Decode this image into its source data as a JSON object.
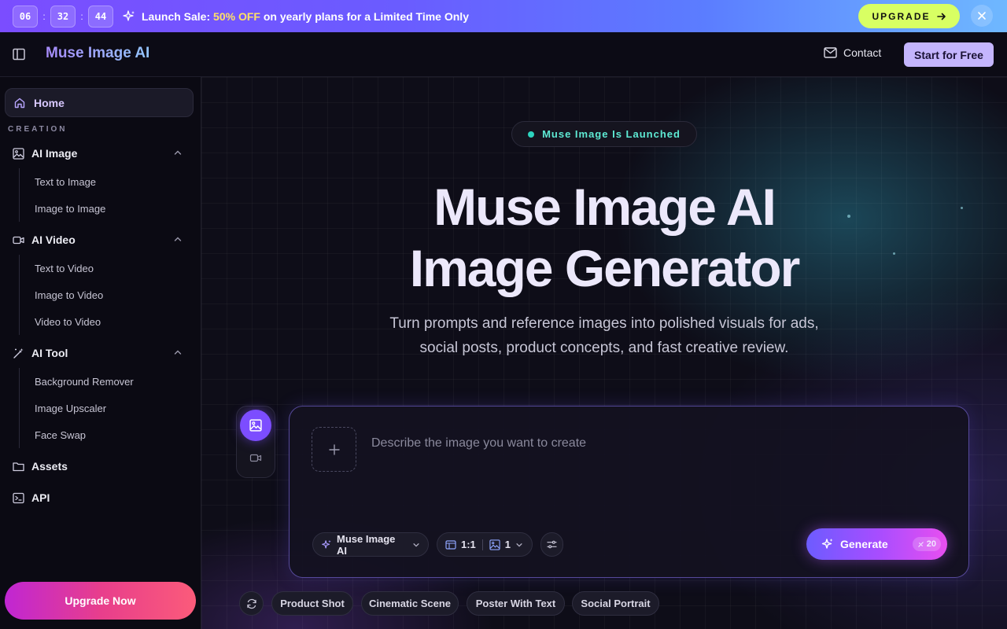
{
  "promo": {
    "hours": "06",
    "minutes": "32",
    "seconds": "44",
    "separator": ":",
    "text_prefix": "Launch Sale: ",
    "text_highlight": "50% OFF",
    "text_suffix": " on yearly plans for a Limited Time Only",
    "upgrade_label": "UPGRADE",
    "highlight_color": "#ffe066",
    "button_color": "#d8ff63"
  },
  "header": {
    "brand": "Muse Image AI",
    "contact_label": "Contact",
    "start_label": "Start for Free"
  },
  "sidebar": {
    "home_label": "Home",
    "section_label": "CREATION",
    "groups": [
      {
        "label": "AI Image",
        "icon": "image-icon",
        "items": [
          "Text to Image",
          "Image to Image"
        ]
      },
      {
        "label": "AI Video",
        "icon": "video-icon",
        "items": [
          "Text to Video",
          "Image to Video",
          "Video to Video"
        ]
      },
      {
        "label": "AI Tool",
        "icon": "magic-wand-icon",
        "items": [
          "Background Remover",
          "Image Upscaler",
          "Face Swap"
        ]
      }
    ],
    "assets_label": "Assets",
    "api_label": "API",
    "upgrade_label": "Upgrade Now"
  },
  "hero": {
    "badge": "Muse Image Is Launched",
    "title_line1": "Muse Image AI",
    "title_line2": "Image Generator",
    "subtitle": "Turn prompts and reference images into polished visuals for ads, social posts, product concepts, and fast creative review."
  },
  "prompt": {
    "placeholder": "Describe the image you want to create",
    "value": "",
    "model": "Muse Image AI",
    "ratio": "1:1",
    "count": "1",
    "generate_label": "Generate",
    "credits": "20"
  },
  "suggestions": [
    "Product Shot",
    "Cinematic Scene",
    "Poster With Text",
    "Social Portrait"
  ],
  "colors": {
    "accent": "#7c4dff",
    "badge_text": "#5eead4",
    "background": "#0e0d18"
  }
}
